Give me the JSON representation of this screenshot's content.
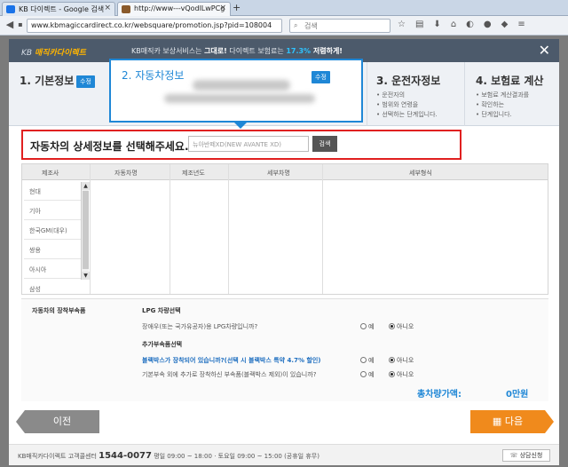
{
  "browser": {
    "tabs": [
      {
        "title": "KB 다이렉트 - Google 검색"
      },
      {
        "title": "http://www---vQodlLwPCg"
      }
    ],
    "new_tab": "+",
    "url": "www.kbmagiccardirect.co.kr/websquare/promotion.jsp?pid=108004",
    "search_placeholder": "검색",
    "colors": {
      "tab_fav_1": "#1a73e8",
      "tab_fav_2": "#8a5a2b"
    }
  },
  "modal": {
    "brand_prefix": "KB",
    "brand_name": "매직카다이렉트",
    "promo": {
      "text1": "KB매직카 보상서비스는 ",
      "highlight": "그대로!",
      "text2": " 다이렉트 보험료는 ",
      "percent": "17.3%",
      "text3": " 저렴하게!"
    },
    "close": "✕"
  },
  "steps": [
    {
      "title": "1. 기본정보",
      "badge": "수정"
    },
    {
      "title": "2. 자동차정보",
      "badge": "수정"
    },
    {
      "title": "3. 운전자정보",
      "desc": [
        "• 운전자의",
        "• 범위와 연령을",
        "• 선택하는 단계입니다."
      ]
    },
    {
      "title": "4. 보험료 계산",
      "desc": [
        "• 보험료 계산결과를",
        "• 확인하는",
        "• 단계입니다."
      ]
    }
  ],
  "selection": {
    "title": "자동차의 상세정보를 선택해주세요.",
    "input_placeholder": "뉴아반떼XD(NEW AVANTE XD)",
    "search_button": "검색"
  },
  "table": {
    "headers": [
      "제조사",
      "자동차명",
      "제조년도",
      "세부차명",
      "세부형식"
    ],
    "makers": [
      "현대",
      "기아",
      "한국GM(대우)",
      "쌍용",
      "아시아",
      "삼성"
    ]
  },
  "options": {
    "label": "자동차의 장착부속품",
    "lpg_title": "LPG 차량선택",
    "lpg_question": "장애우(또는 국가유공자)용 LPG차량입니까?",
    "accessory_title": "추가부속품선택",
    "blackbox_question": "블랙박스가 장착되어 있습니까?(선택 시 블랙박스 특약 4.7% 할인)",
    "extra_question": "기본부속 외에 추가로 장착하신 부속품(블랙박스 제외)이 있습니까?",
    "yes": "예",
    "no": "아니오",
    "total_label": "총차량가액:",
    "total_value": "0만원"
  },
  "nav": {
    "prev": "이전",
    "next": "다음"
  },
  "footer": {
    "center": "KB매직카다이렉트 고객콜센터",
    "tel": "1544-0077",
    "hours": "평일 09:00 ~ 18:00 · 토요일 09:00 ~ 15:00 (공휴일 휴무)",
    "consult": "상담신청"
  }
}
